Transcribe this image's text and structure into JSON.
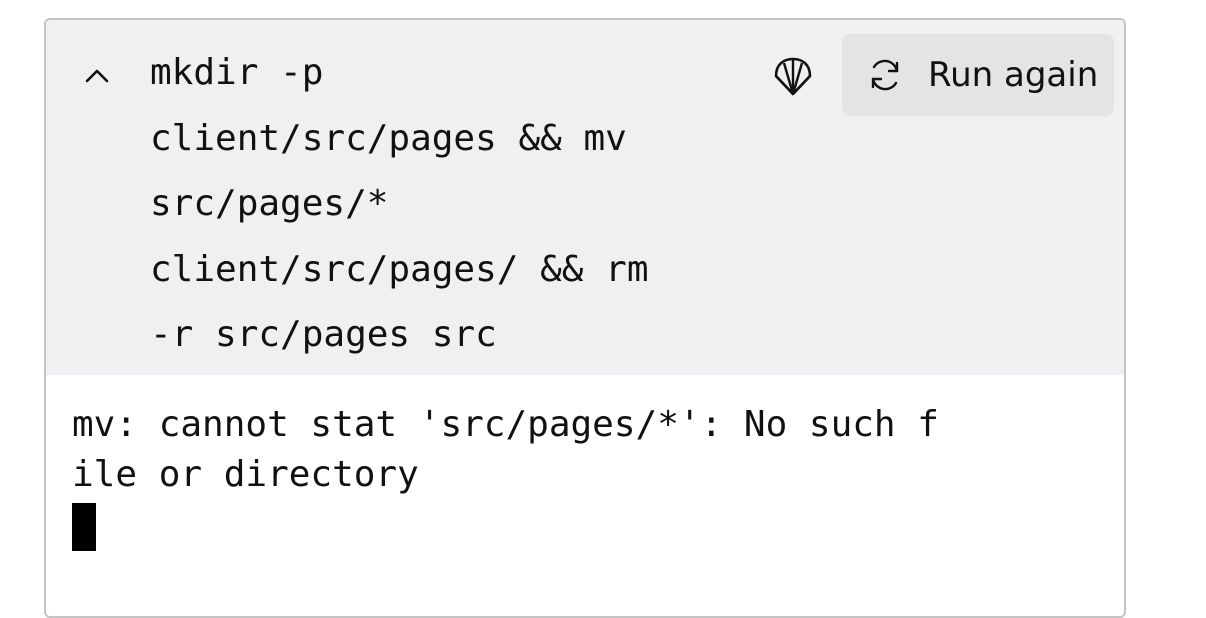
{
  "command": {
    "lines": [
      "mkdir -p",
      "client/src/pages && mv",
      "src/pages/*",
      "client/src/pages/ && rm",
      "-r src/pages src"
    ],
    "collapse_icon": "chevron-up-icon",
    "shell_icon": "shell-icon"
  },
  "run_again": {
    "label": "Run again",
    "icon": "refresh-icon"
  },
  "output": {
    "lines": [
      "mv: cannot stat 'src/pages/*': No such f",
      "ile or directory"
    ],
    "cursor": "block-cursor"
  },
  "colors": {
    "command_background": "#f0f0f2",
    "button_background": "#e4e4e7",
    "border": "#c4c4c8",
    "text": "#111111"
  }
}
